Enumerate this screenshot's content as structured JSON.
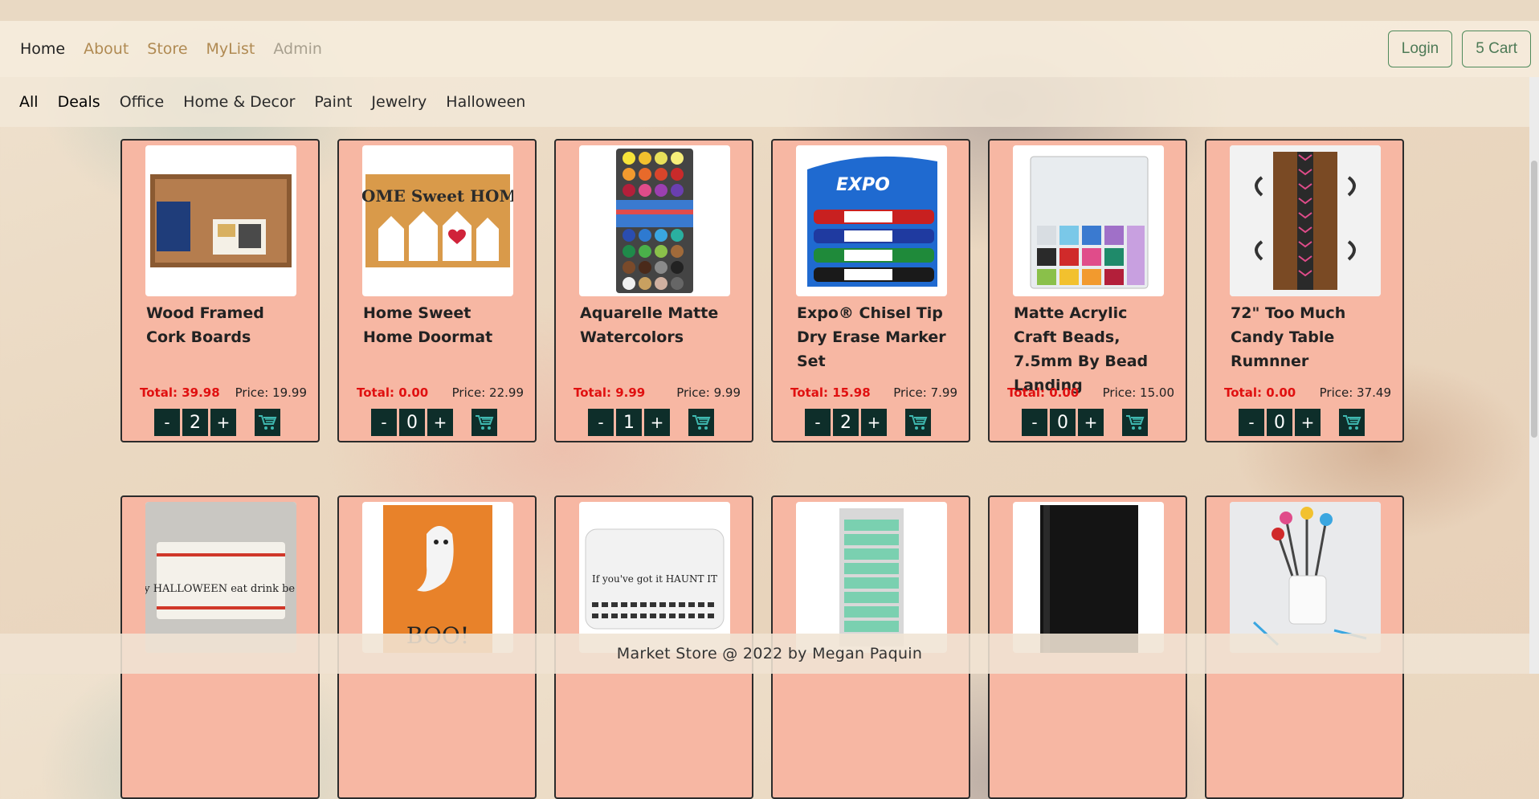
{
  "nav": {
    "links": [
      "Home",
      "About",
      "Store",
      "MyList",
      "Admin"
    ],
    "login_label": "Login",
    "cart_label": "5 Cart"
  },
  "categories": [
    "All",
    "Deals",
    "Office",
    "Home & Decor",
    "Paint",
    "Jewelry",
    "Halloween"
  ],
  "products": [
    {
      "name": "Wood Framed Cork Boards",
      "total": "Total: 39.98",
      "price": "Price: 19.99",
      "qty": "2"
    },
    {
      "name": "Home Sweet Home Doormat",
      "total": "Total: 0.00",
      "price": "Price: 22.99",
      "qty": "0",
      "image_text": "HOME Sweet HOME"
    },
    {
      "name": "Aquarelle Matte Watercolors",
      "total": "Total: 9.99",
      "price": "Price: 9.99",
      "qty": "1"
    },
    {
      "name": "Expo® Chisel Tip Dry Erase Marker Set",
      "total": "Total: 15.98",
      "price": "Price: 7.99",
      "qty": "2",
      "image_text": "EXPO"
    },
    {
      "name": "Matte Acrylic Craft Beads, 7.5mm By Bead Landing",
      "total": "Total: 0.00",
      "price": "Price: 15.00",
      "qty": "0"
    },
    {
      "name": "72\" Too Much Candy Table Rumnner",
      "total": "Total: 0.00",
      "price": "Price: 37.49",
      "qty": "0"
    }
  ],
  "products_row2_images": [
    "Happy HALLOWEEN eat drink be scary",
    "BOO!",
    "If you've got it HAUNT IT",
    "",
    "",
    ""
  ],
  "controls": {
    "minus": "-",
    "plus": "+"
  },
  "footer": "Market Store @ 2022 by Megan Paquin"
}
